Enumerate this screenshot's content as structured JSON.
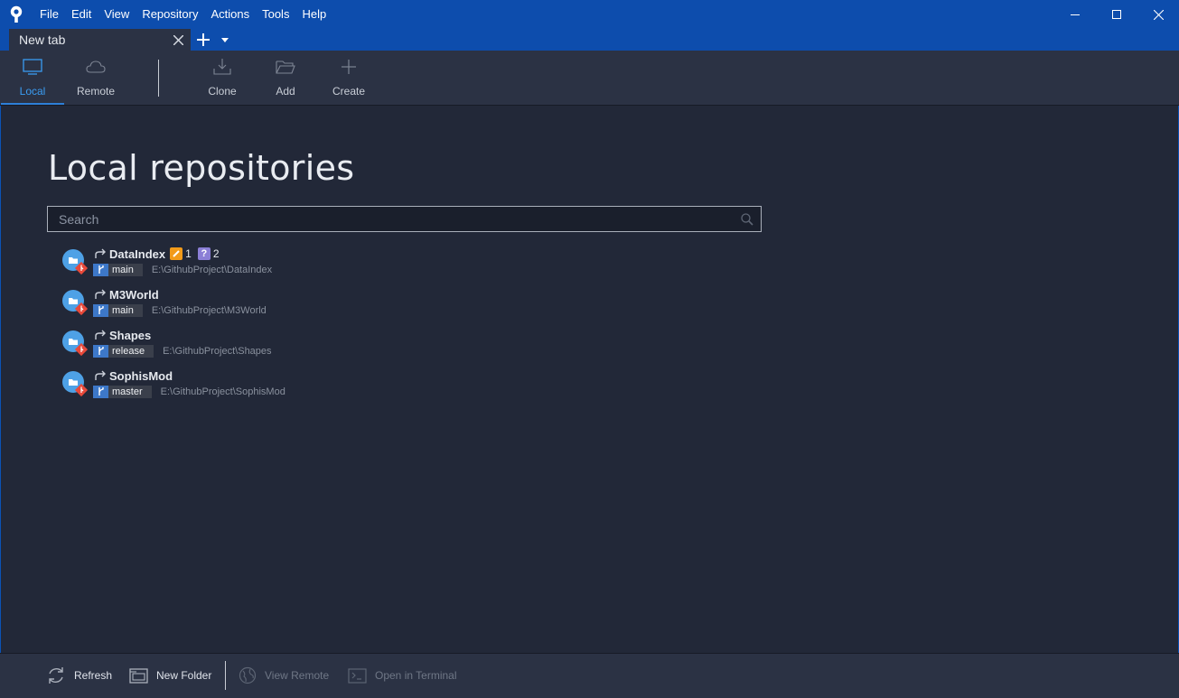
{
  "menu": [
    "File",
    "Edit",
    "View",
    "Repository",
    "Actions",
    "Tools",
    "Help"
  ],
  "tab": {
    "label": "New tab"
  },
  "toolbar": {
    "local": "Local",
    "remote": "Remote",
    "clone": "Clone",
    "add": "Add",
    "create": "Create"
  },
  "main": {
    "title": "Local repositories",
    "search_placeholder": "Search"
  },
  "repos": [
    {
      "name": "DataIndex",
      "branch": "main",
      "path": "E:\\GithubProject\\DataIndex",
      "modified": "1",
      "untracked": "2"
    },
    {
      "name": "M3World",
      "branch": "main",
      "path": "E:\\GithubProject\\M3World"
    },
    {
      "name": "Shapes",
      "branch": "release",
      "path": "E:\\GithubProject\\Shapes"
    },
    {
      "name": "SophisMod",
      "branch": "master",
      "path": "E:\\GithubProject\\SophisMod"
    }
  ],
  "badge_unknown_glyph": "?",
  "bottom": {
    "refresh": "Refresh",
    "new_folder": "New Folder",
    "view_remote": "View Remote",
    "open_terminal": "Open in Terminal"
  },
  "colors": {
    "titlebar": "#0d4dad",
    "background": "#222838",
    "panel": "#2b3244",
    "accent": "#2d7fd8",
    "modified_badge": "#f29b1a",
    "untracked_badge": "#8b7fd6",
    "branch_badge": "#3d78c9"
  },
  "icons": {
    "app": "sourcetree-logo-icon",
    "minimize": "minimize-icon",
    "maximize": "maximize-icon",
    "close": "close-icon"
  }
}
